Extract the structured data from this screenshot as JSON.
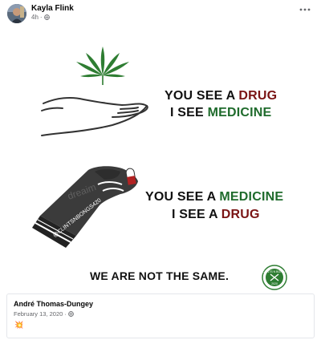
{
  "post": {
    "author": "Kayla Flink",
    "time": "4h",
    "audience_icon": "globe-icon",
    "more_icon": "more-options-icon"
  },
  "meme": {
    "line1_prefix": "YOU SEE A ",
    "line1_word": "DRUG",
    "line2_prefix": "I SEE ",
    "line2_word": "MEDICINE",
    "line3_prefix": "YOU SEE A ",
    "line3_word": "MEDICINE",
    "line4_prefix": "I SEE A ",
    "line4_word": "DRUG",
    "slogan": "WE ARE NOT THE SAME.",
    "watermark": "dreaim",
    "arm_tag": "@CLINTSNBONGS420",
    "badge_text": "CLINTS N BONGS",
    "badge_year": "2020",
    "colors": {
      "green_word": "#1f6b2c",
      "red_word": "#7a1414",
      "leaf": "#2e7d32"
    }
  },
  "comment": {
    "author": "André Thomas-Dungey",
    "date": "February 13, 2020",
    "separator": "·",
    "emoji": "💥"
  }
}
